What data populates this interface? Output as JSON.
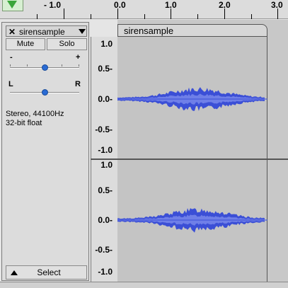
{
  "ruler": {
    "labels": [
      "- 1.0",
      "0.0",
      "1.0",
      "2.0",
      "3.0"
    ]
  },
  "track": {
    "name": "sirensample",
    "mute_label": "Mute",
    "solo_label": "Solo",
    "gain_minus": "-",
    "gain_plus": "+",
    "pan_left": "L",
    "pan_right": "R",
    "gain_value": 0.5,
    "pan_value": 0.5,
    "format_line1": "Stereo, 44100Hz",
    "format_line2": "32-bit float",
    "select_label": "Select"
  },
  "channels": [
    {
      "clip_name": "sirensample",
      "scale_labels": [
        "1.0",
        "0.5-",
        "0.0-",
        "-0.5-",
        "-1.0"
      ]
    },
    {
      "scale_labels": [
        "1.0",
        "0.5-",
        "0.0-",
        "-0.5-",
        "-1.0"
      ]
    }
  ],
  "colors": {
    "waveform": "#3b4fd6",
    "waveform_rms": "#6f7fe8",
    "play_green": "#3aa63a"
  },
  "icons": {
    "play_head": "down-triangle",
    "close": "x-mark",
    "menu": "chevron-down",
    "collapse": "up-triangle"
  }
}
